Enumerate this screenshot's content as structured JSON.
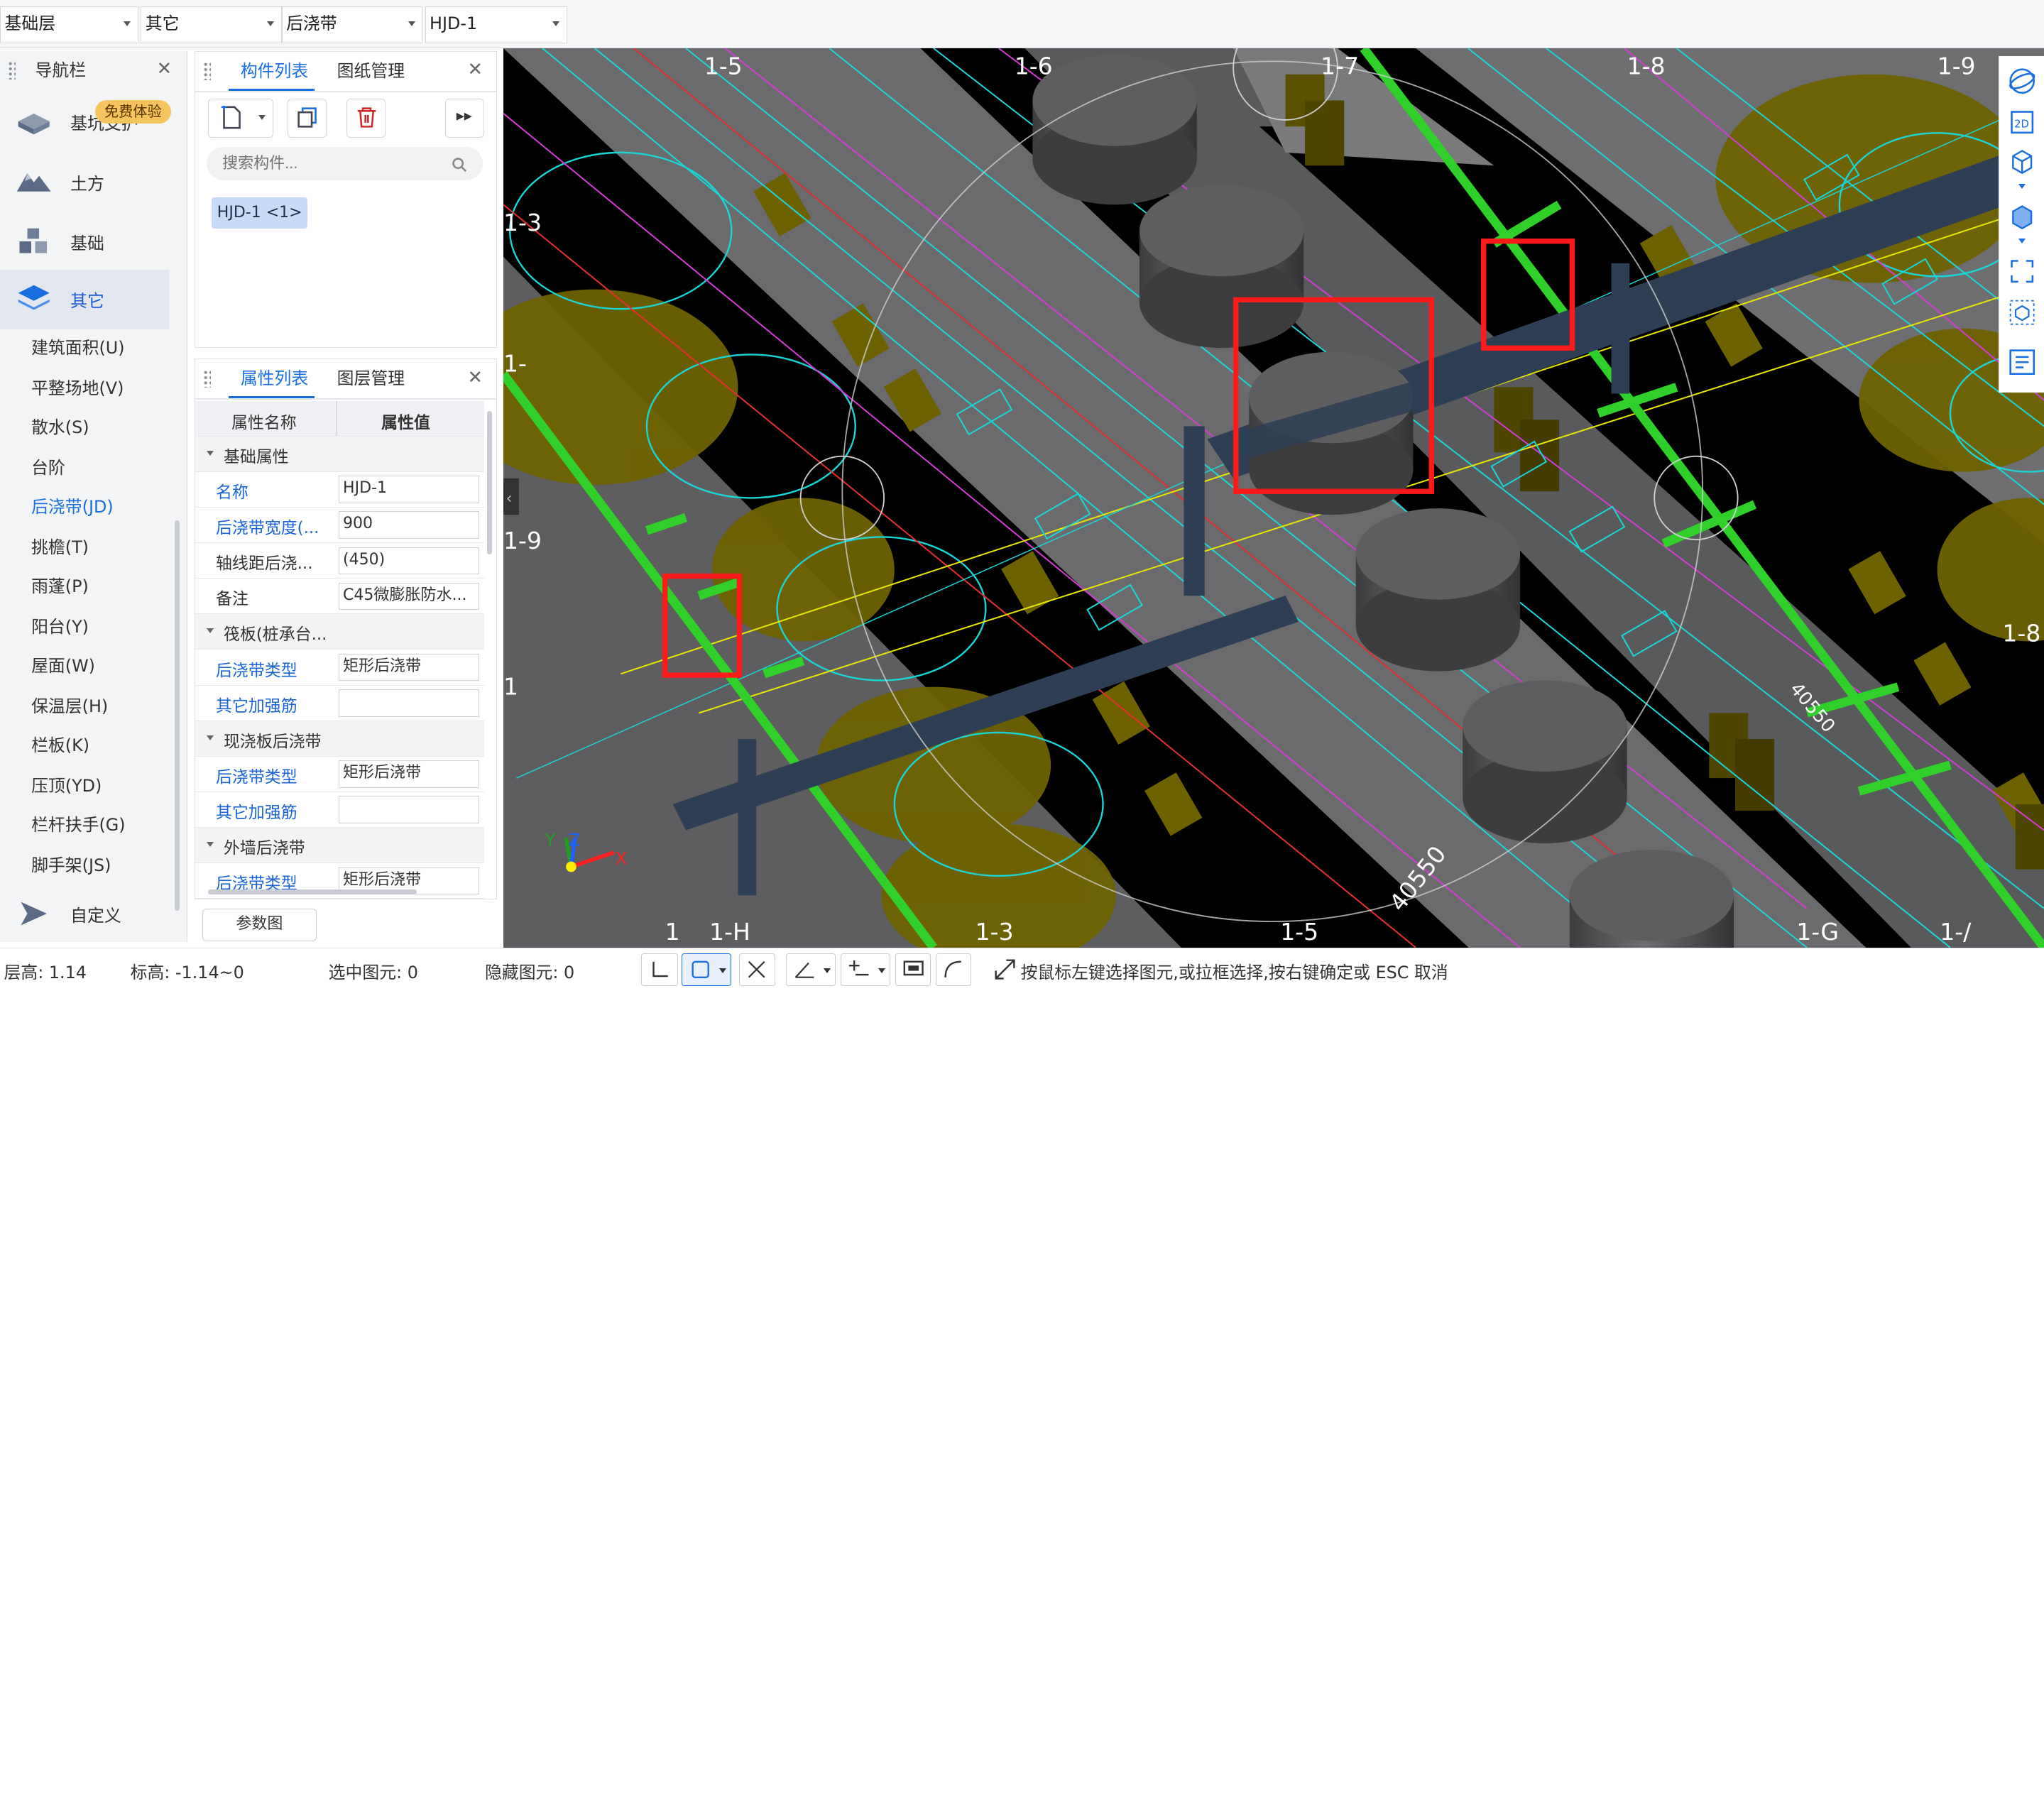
{
  "topbar": {
    "selects": [
      {
        "value": "基础层"
      },
      {
        "value": "其它"
      },
      {
        "value": "后浇带"
      },
      {
        "value": "HJD-1"
      }
    ]
  },
  "nav": {
    "title": "导航栏",
    "trial_badge": "免费体验",
    "categories": [
      {
        "label": "基坑支护",
        "icon": "foundation-pit-icon"
      },
      {
        "label": "土方",
        "icon": "earthwork-icon"
      },
      {
        "label": "基础",
        "icon": "foundation-icon"
      },
      {
        "label": "其它",
        "icon": "layers-icon"
      }
    ],
    "sub_items": [
      {
        "label": "建筑面积(U)"
      },
      {
        "label": "平整场地(V)"
      },
      {
        "label": "散水(S)"
      },
      {
        "label": "台阶"
      },
      {
        "label": "后浇带(JD)"
      },
      {
        "label": "挑檐(T)"
      },
      {
        "label": "雨蓬(P)"
      },
      {
        "label": "阳台(Y)"
      },
      {
        "label": "屋面(W)"
      },
      {
        "label": "保温层(H)"
      },
      {
        "label": "栏板(K)"
      },
      {
        "label": "压顶(YD)"
      },
      {
        "label": "栏杆扶手(G)"
      },
      {
        "label": "脚手架(JS)"
      }
    ],
    "custom": {
      "label": "自定义",
      "icon": "custom-icon"
    }
  },
  "component_panel": {
    "tabs": [
      {
        "label": "构件列表"
      },
      {
        "label": "图纸管理"
      }
    ],
    "search_placeholder": "搜索构件...",
    "items": [
      {
        "label": "HJD-1 <1>"
      }
    ]
  },
  "property_panel": {
    "tabs": [
      {
        "label": "属性列表"
      },
      {
        "label": "图层管理"
      }
    ],
    "columns": {
      "name": "属性名称",
      "value": "属性值"
    },
    "rows": [
      {
        "type": "group",
        "label": "基础属性"
      },
      {
        "type": "prop",
        "name": "名称",
        "value": "HJD-1",
        "blue": true
      },
      {
        "type": "prop",
        "name": "后浇带宽度(...",
        "value": "900",
        "blue": true
      },
      {
        "type": "prop",
        "name": "轴线距后浇...",
        "value": "(450)",
        "blue": false
      },
      {
        "type": "prop",
        "name": "备注",
        "value": "C45微膨胀防水...",
        "blue": false
      },
      {
        "type": "group",
        "label": "筏板(桩承台..."
      },
      {
        "type": "prop",
        "name": "后浇带类型",
        "value": "矩形后浇带",
        "blue": true
      },
      {
        "type": "prop",
        "name": "其它加强筋",
        "value": "",
        "blue": true
      },
      {
        "type": "group",
        "label": "现浇板后浇带"
      },
      {
        "type": "prop",
        "name": "后浇带类型",
        "value": "矩形后浇带",
        "blue": true
      },
      {
        "type": "prop",
        "name": "其它加强筋",
        "value": "",
        "blue": true
      },
      {
        "type": "group",
        "label": "外墙后浇带"
      },
      {
        "type": "prop",
        "name": "后浇带类型",
        "value": "矩形后浇带",
        "blue": true
      }
    ],
    "param_button": "参数图"
  },
  "viewport": {
    "axis_labels_top": [
      "1-5",
      "1-6",
      "1-7",
      "1-8",
      "1-9"
    ],
    "axis_labels_bottom": [
      "1",
      "1-H",
      "1-3",
      "1-5",
      "1-G",
      "1-/"
    ],
    "axis_labels_left": [
      "1-3",
      "1-",
      "1-9",
      "1"
    ],
    "axis_labels_right": [
      "1-8"
    ],
    "dimension_labels": [
      "40550",
      "40550"
    ],
    "axis_gizmo": {
      "x": "X",
      "y": "Y",
      "z": "Z"
    },
    "colors": {
      "background": "#000000",
      "slab": "#6c6c6e",
      "green_bar": "#2fd02a",
      "cyan": "#19d6d6",
      "magenta": "#d23cd2",
      "yellow": "#e6e600",
      "olive": "#6e6200",
      "highlight": "#ff1a1a"
    }
  },
  "right_toolbar": {
    "tools": [
      {
        "icon": "globe-icon"
      },
      {
        "icon": "2d-view-icon"
      },
      {
        "icon": "cube-icon"
      },
      {
        "icon": "cube-solid-icon"
      },
      {
        "icon": "fullscreen-icon"
      },
      {
        "icon": "box-select-icon"
      },
      {
        "icon": "layer-list-icon"
      }
    ]
  },
  "status": {
    "floor_height": "层高:  1.14",
    "elevation": "标高:  -1.14~0",
    "selected": "选中图元:  0",
    "hidden": "隐藏图元:  0",
    "hint": "按鼠标左键选择图元,或拉框选择,按右键确定或 ESC 取消"
  }
}
